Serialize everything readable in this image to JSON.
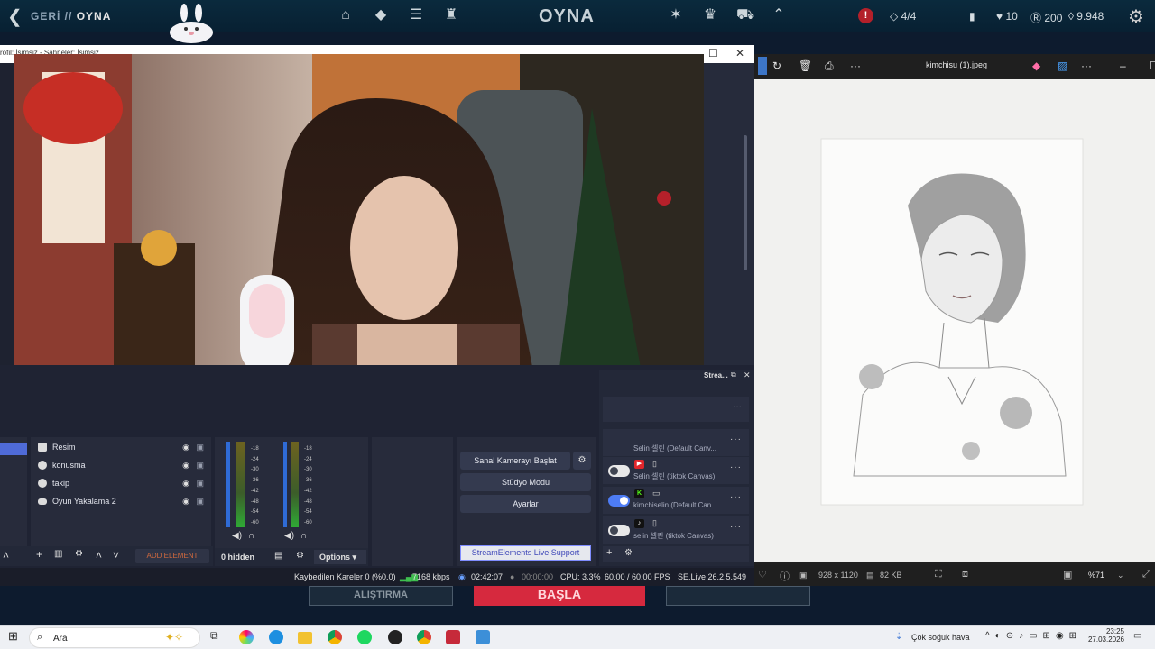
{
  "lol_bar": {
    "back_glyph": "❮",
    "crumb_back": "GERİ //",
    "crumb_current": "OYNA",
    "title": "OYNA",
    "alert_glyph": "!",
    "party": "4/4",
    "honor": "10",
    "rp": "200",
    "be": "9.948",
    "accent_color": "#c8aa6e"
  },
  "obs_window": {
    "title": "rofil: İsimsiz - Sahneler: İsimsiz",
    "maximize_glyph": "☐",
    "close_glyph": "✕"
  },
  "sources": {
    "items": [
      {
        "label": "Resim",
        "icon": "image-icon"
      },
      {
        "label": "konusma",
        "icon": "globe-icon"
      },
      {
        "label": "takip",
        "icon": "globe-icon"
      },
      {
        "label": "Oyun Yakalama 2",
        "icon": "gamepad-icon"
      }
    ],
    "add_element": "ADD ELEMENT",
    "eye_glyph": "◉",
    "lock_glyph": "🔒"
  },
  "mixer": {
    "ticks": [
      "-18",
      "-24",
      "-30",
      "-36",
      "-42",
      "-48",
      "-54",
      "-60"
    ],
    "hidden_label": "0 hidden",
    "options_label": "Options"
  },
  "controls": {
    "virtual_cam": "Sanal Kamerayı Başlat",
    "studio_mode": "Stüdyo Modu",
    "settings": "Ayarlar",
    "se_support": "StreamElements Live Support"
  },
  "destinations": {
    "header": "Strea...",
    "items": [
      {
        "name": "Selin 셀린 (Default Canv...",
        "on": false,
        "platform": "none",
        "device": ""
      },
      {
        "name": "Selin 셀린 (tiktok Canvas)",
        "on": false,
        "platform": "youtube",
        "device": "phone"
      },
      {
        "name": "kimchiselin (Default Can...",
        "on": true,
        "platform": "kick",
        "device": "desktop"
      },
      {
        "name": "selin 셀린 (tiktok Canvas)",
        "on": false,
        "platform": "tiktok",
        "device": "phone"
      }
    ]
  },
  "status": {
    "dropped": "Kaybedilen Kareler 0 (%0.0)",
    "bitrate": "7168 kbps",
    "live_time": "02:42:07",
    "rec_time": "00:00:00",
    "cpu": "CPU: 3.3%",
    "fps": "60.00 / 60.00 FPS",
    "version": "SE.Live 26.2.5.549"
  },
  "lol_bottom": {
    "practice": "ALIŞTIRMA",
    "start": "BAŞLA"
  },
  "viewer": {
    "filename": "kimchisu (1).jpeg",
    "dimensions": "928 x 1120",
    "size": "82 KB",
    "zoom": "%71"
  },
  "taskbar": {
    "search": "Ara",
    "weather": "Çok soğuk hava",
    "time": "23:25",
    "date": "27.03.2026"
  }
}
